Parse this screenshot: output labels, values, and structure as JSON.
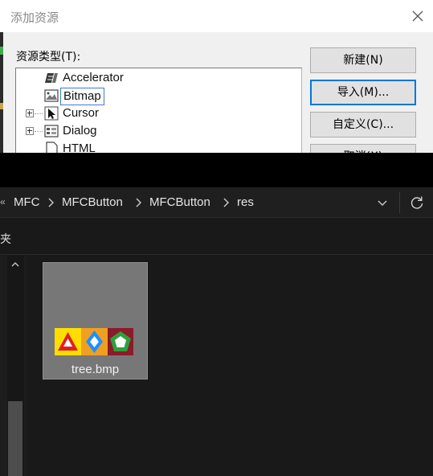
{
  "dialog": {
    "title": "添加资源",
    "type_label": "资源类型(T):",
    "resource_types": [
      {
        "label": "Accelerator",
        "icon": "accelerator-icon",
        "expandable": false,
        "selected": false
      },
      {
        "label": "Bitmap",
        "icon": "bitmap-icon",
        "expandable": false,
        "selected": true
      },
      {
        "label": "Cursor",
        "icon": "cursor-icon",
        "expandable": true,
        "selected": false
      },
      {
        "label": "Dialog",
        "icon": "dialog-icon",
        "expandable": true,
        "selected": false
      },
      {
        "label": "HTML",
        "icon": "html-icon",
        "expandable": false,
        "selected": false
      }
    ],
    "buttons": {
      "new": "新建(N)",
      "import": "导入(M)...",
      "custom": "自定义(C)...",
      "cancel": "取消(X)"
    },
    "colors": {
      "accent": "#0078d7"
    }
  },
  "explorer": {
    "breadcrumb_lead": "«",
    "breadcrumbs": [
      "MFC",
      "MFCButton",
      "MFCButton",
      "res"
    ],
    "nav_text": "夹",
    "files": [
      {
        "name": "tree.bmp",
        "thumbnail_colors": [
          "#ffdd00",
          "#e02020",
          "#1e90ff",
          "#2e9f3e",
          "#8b1a2a"
        ]
      }
    ],
    "colors": {
      "background": "#191919",
      "tile": "#777777"
    }
  }
}
